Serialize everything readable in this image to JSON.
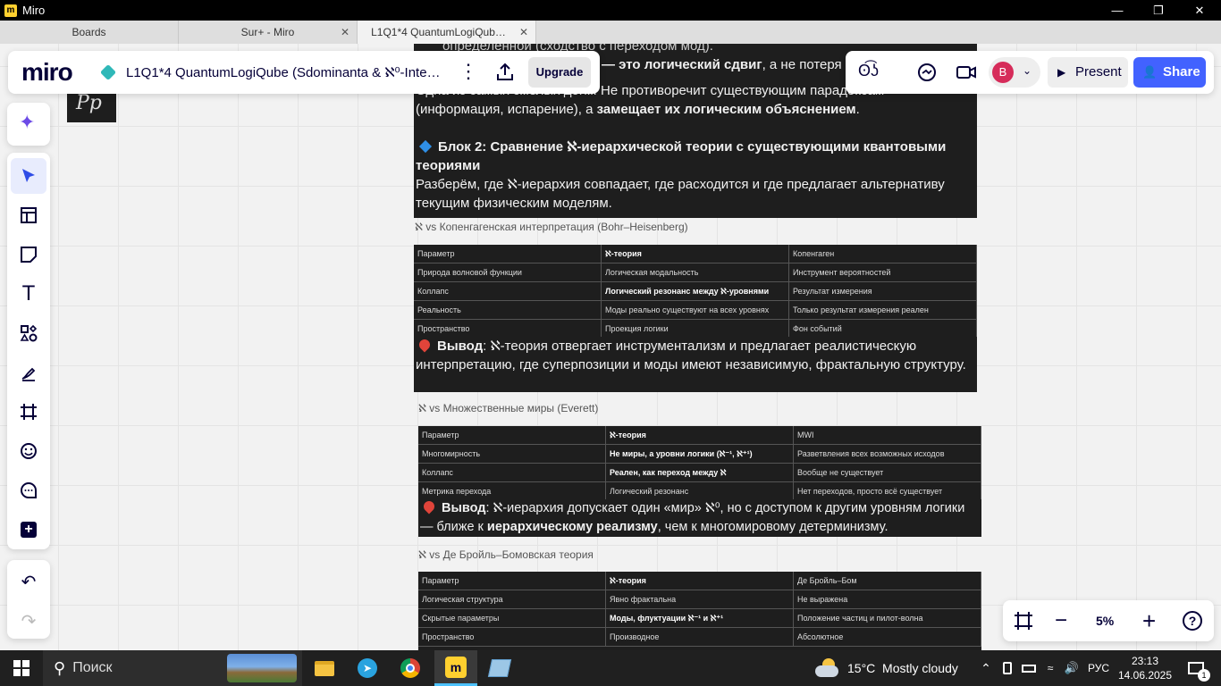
{
  "window": {
    "title": "Miro"
  },
  "tabs": [
    {
      "label": "Boards"
    },
    {
      "label": "Sur+ - Miro"
    },
    {
      "label": "L1Q1*4 QuantumLogiQub…"
    }
  ],
  "topbar": {
    "logo": "miro",
    "board_title": "L1Q1*4 QuantumLogiQube (Sdominanta & ℵ⁰-Inte…",
    "upgrade": "Upgrade",
    "reactions": "ʘ͡ʖ",
    "avatar_letter": "B",
    "present": "Present",
    "share": "Share",
    "accent": "#4262ff"
  },
  "canvas": {
    "top_partial": "определённой (сходство с переходом мод).",
    "shift_bold": "— это логический сдвиг",
    "shift_rest": ", а не потеря",
    "para1_a": "Одна из самых смелых догм. Не противоречит существующим парадоксам (информация, испарение), а ",
    "para1_b": "замещает их логическим объяснением",
    "para1_c": ".",
    "block2_title": "Блок 2: Сравнение ℵ-иерархической теории с существующими квантовыми теориями",
    "block2_text": "Разберём, где ℵ-иерархия совпадает, где расходится и где предлагает альтернативу текущим физическим моделям.",
    "h1": "ℵ vs Копенгагенская интерпретация (Bohr–Heisenberg)",
    "t1": [
      [
        "Параметр",
        "ℵ-теория",
        "Копенгаген"
      ],
      [
        "Природа волновой функции",
        "Логическая модальность",
        "Инструмент вероятностей"
      ],
      [
        "Коллапс",
        "Логический резонанс между ℵ-уровнями",
        "Результат измерения"
      ],
      [
        "Реальность",
        "Моды реально существуют на всех уровнях",
        "Только результат измерения реален"
      ],
      [
        "Пространство",
        "Проекция логики",
        "Фон событий"
      ]
    ],
    "c1_label": "Вывод",
    "c1_text": ": ℵ-теория отвергает инструментализм и предлагает реалистическую интерпретацию, где суперпозиции и моды имеют независимую, фрактальную структуру.",
    "h2": "ℵ vs Множественные миры (Everett)",
    "t2": [
      [
        "Параметр",
        "ℵ-теория",
        "MWI"
      ],
      [
        "Многомирность",
        "Не миры, а уровни логики (ℵ⁻¹, ℵ⁺¹)",
        "Разветвления всех возможных исходов"
      ],
      [
        "Коллапс",
        "Реален, как переход между ℵ",
        "Вообще не существует"
      ],
      [
        "Метрика перехода",
        "Логический резонанс",
        "Нет переходов, просто всё существует"
      ]
    ],
    "c2_label": "Вывод",
    "c2_a": ": ℵ-иерархия допускает один «мир» ℵ⁰, но с доступом к другим уровням логики — ближе к ",
    "c2_b": "иерархическому реализму",
    "c2_c": ", чем к многомировому детерминизму.",
    "h3": "ℵ vs Де Бройль–Бомовская теория",
    "t3": [
      [
        "Параметр",
        "ℵ-теория",
        "Де Бройль–Бом"
      ],
      [
        "Логическая структура",
        "Явно фрактальна",
        "Не выражена"
      ],
      [
        "Скрытые параметры",
        "Моды, флуктуации ℵ⁻¹ и ℵ⁺¹",
        "Положение частиц и пилот-волна"
      ],
      [
        "Пространство",
        "Производное",
        "Абсолютное"
      ]
    ],
    "corner_glyph": "Pp"
  },
  "zoom": {
    "level": "5%"
  },
  "taskbar": {
    "search": "Поиск",
    "weather": "15°C  Mostly cloudy",
    "lang": "РУС",
    "time": "23:13",
    "date": "14.06.2025",
    "notif": "1"
  }
}
